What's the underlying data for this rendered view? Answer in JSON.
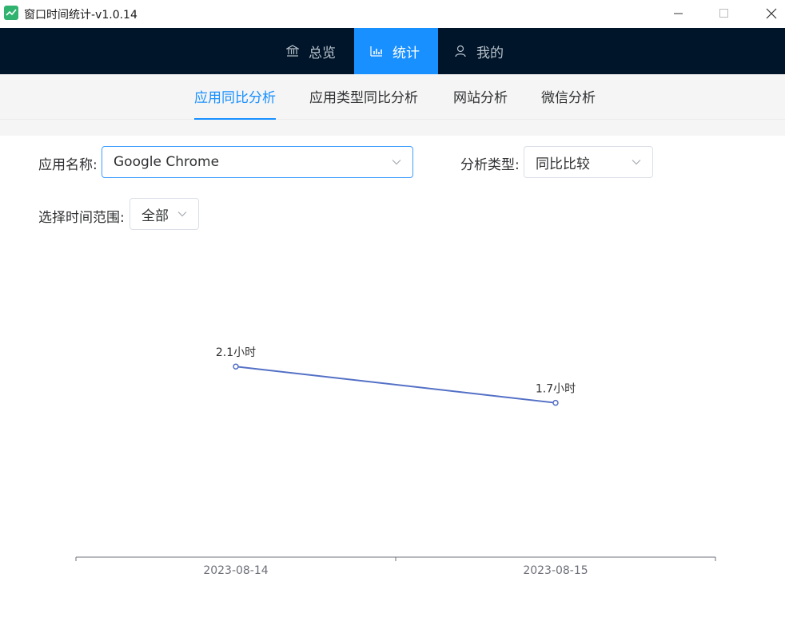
{
  "window": {
    "title": "窗口时间统计-v1.0.14"
  },
  "topnav": {
    "items": [
      {
        "label": "总览",
        "icon": "bank-icon"
      },
      {
        "label": "统计",
        "icon": "bar-chart-icon"
      },
      {
        "label": "我的",
        "icon": "user-icon"
      }
    ],
    "active_index": 1
  },
  "subtabs": {
    "items": [
      "应用同比分析",
      "应用类型同比分析",
      "网站分析",
      "微信分析"
    ],
    "active_index": 0
  },
  "form": {
    "app_label": "应用名称:",
    "app_value": "Google Chrome",
    "type_label": "分析类型:",
    "type_value": "同比比较",
    "range_label": "选择时间范围:",
    "range_value": "全部"
  },
  "colors": {
    "accent": "#1890ff",
    "nav_bg": "#001529",
    "series": "#5470c6"
  },
  "chart_data": {
    "type": "line",
    "x": [
      "2023-08-14",
      "2023-08-15"
    ],
    "series": [
      {
        "values": [
          2.1,
          1.7
        ],
        "labels": [
          "2.1小时",
          "1.7小时"
        ]
      }
    ],
    "title": "",
    "xlabel": "",
    "ylabel": "",
    "ylim": [
      0,
      3.5
    ],
    "grid": false
  }
}
